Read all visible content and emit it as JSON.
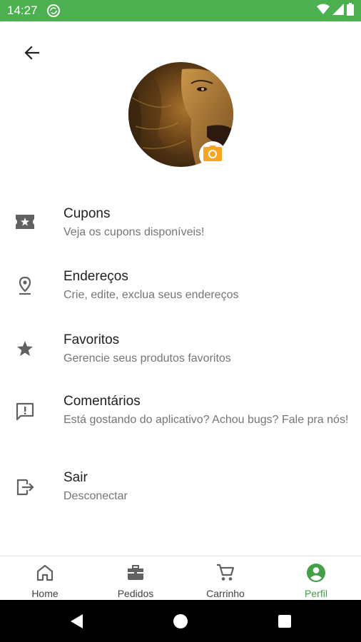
{
  "status_bar": {
    "time": "14:27",
    "background_color": "#4caf50",
    "icons": [
      "sync-icon",
      "wifi-icon",
      "signal-icon",
      "battery-icon"
    ]
  },
  "header": {
    "back_icon": "arrow-back-icon"
  },
  "profile": {
    "avatar_description_icon": "lion-avatar-image",
    "camera_icon": "camera-icon",
    "camera_color": "#f5a623"
  },
  "menu": {
    "items": [
      {
        "title": "Cupons",
        "subtitle": "Veja os cupons disponíveis!",
        "icon": "ticket-icon"
      },
      {
        "title": "Endereços",
        "subtitle": "Crie, edite, exclua seus endereços",
        "icon": "location-pin-icon"
      },
      {
        "title": "Favoritos",
        "subtitle": "Gerencie seus produtos favoritos",
        "icon": "star-icon"
      },
      {
        "title": "Comentários",
        "subtitle": "Está gostando do aplicativo? Achou bugs? Fale pra nós!",
        "icon": "feedback-icon"
      },
      {
        "title": "Sair",
        "subtitle": "Desconectar",
        "icon": "logout-icon"
      }
    ]
  },
  "bottom_nav": {
    "items": [
      {
        "label": "Home",
        "icon": "home-icon",
        "active": false
      },
      {
        "label": "Pedidos",
        "icon": "orders-icon",
        "active": false
      },
      {
        "label": "Carrinho",
        "icon": "cart-icon",
        "active": false
      },
      {
        "label": "Perfil",
        "icon": "profile-icon",
        "active": true
      }
    ],
    "active_color": "#43a047"
  },
  "system_nav": {
    "icons": [
      "back-triangle-icon",
      "home-circle-icon",
      "recents-square-icon"
    ]
  }
}
